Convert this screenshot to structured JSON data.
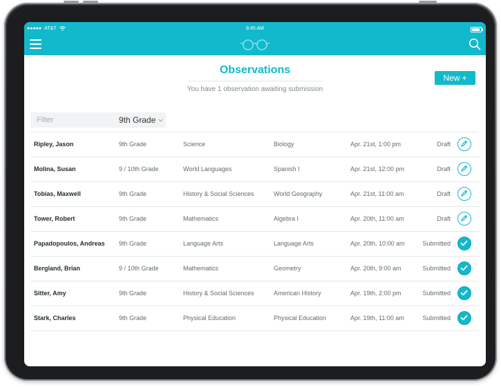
{
  "status_bar": {
    "carrier": "AT&T",
    "time": "8:45 AM"
  },
  "header": {
    "menu_icon": "hamburger-menu-icon",
    "logo_icon": "glasses-icon",
    "search_icon": "search-icon"
  },
  "page": {
    "title": "Observations",
    "subtitle": "You have 1 observation awaiting submission",
    "new_button_label": "New",
    "new_button_glyph": "+"
  },
  "filter": {
    "placeholder": "Filter",
    "grade_selected": "9th Grade"
  },
  "colors": {
    "accent": "#12b9cc"
  },
  "rows": [
    {
      "name": "Ripley, Jason",
      "grade": "9th Grade",
      "subject": "Science",
      "course": "Biology",
      "date": "Apr. 21st, 1:00 pm",
      "status": "Draft",
      "action": "edit"
    },
    {
      "name": "Molina, Susan",
      "grade": "9 / 10th Grade",
      "subject": "World Languages",
      "course": "Spanish I",
      "date": "Apr. 21st, 12:00 pm",
      "status": "Draft",
      "action": "edit"
    },
    {
      "name": "Tobias, Maxwell",
      "grade": "9th Grade",
      "subject": "History & Social Sciences",
      "course": "World Geography",
      "date": "Apr. 21st, 11:00 am",
      "status": "Draft",
      "action": "edit"
    },
    {
      "name": "Tower, Robert",
      "grade": "9th Grade",
      "subject": "Mathematics",
      "course": "Algebra I",
      "date": "Apr. 20th, 11:00 am",
      "status": "Draft",
      "action": "edit"
    },
    {
      "name": "Papadopoulos, Andreas",
      "grade": "9th Grade",
      "subject": "Language Arts",
      "course": "Language Arts",
      "date": "Apr. 20th, 10:00 am",
      "status": "Submitted",
      "action": "done"
    },
    {
      "name": "Bergland, Brian",
      "grade": "9 / 10th Grade",
      "subject": "Mathematics",
      "course": "Geometry",
      "date": "Apr. 20th, 9:00 am",
      "status": "Submitted",
      "action": "done"
    },
    {
      "name": "Sitter, Amy",
      "grade": "9th Grade",
      "subject": "History & Social Sciences",
      "course": "American History",
      "date": "Apr. 19th, 2:00 pm",
      "status": "Submitted",
      "action": "done"
    },
    {
      "name": "Stark, Charles",
      "grade": "9th Grade",
      "subject": "Physical Education",
      "course": "Physical Education",
      "date": "Apr. 19th, 11:00 am",
      "status": "Submitted",
      "action": "done"
    }
  ]
}
